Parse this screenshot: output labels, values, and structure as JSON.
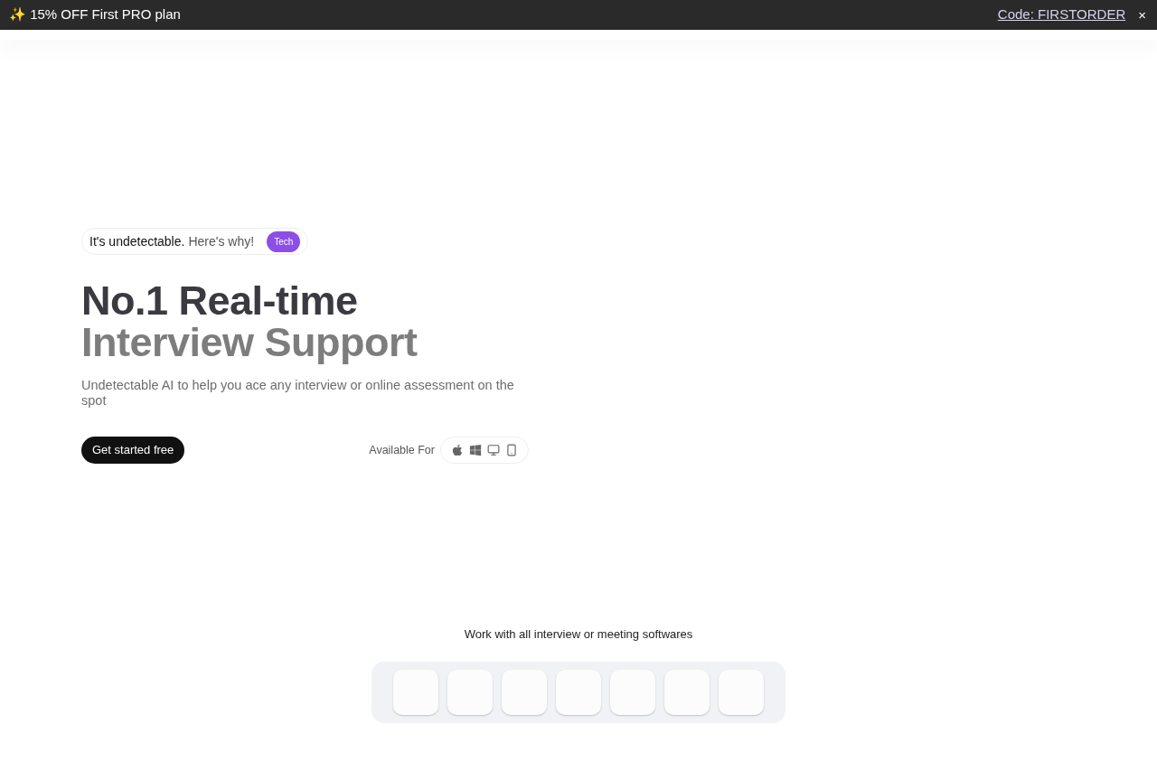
{
  "promo_banner": {
    "text": "✨ 15% OFF First PRO plan",
    "code_link": "Code: FIRSTORDER",
    "close": "×"
  },
  "hero": {
    "pill": {
      "text": "It's undetectable.",
      "link": "Here's why!",
      "badge": "Tech"
    },
    "title_line_1": "No.1 Real-time",
    "title_line_2": "Interview Support",
    "subtitle": "Undetectable AI to help you ace any interview or online assessment on the spot",
    "cta": "Get started free",
    "available_label": "Available For",
    "platforms": [
      {
        "kind": "apple"
      },
      {
        "kind": "windows"
      },
      {
        "kind": "desktop"
      },
      {
        "kind": "mobile"
      }
    ]
  },
  "software": {
    "heading": "Work with all interview or meeting softwares",
    "tiles": [
      {
        "kind": "blank"
      },
      {
        "kind": "blank"
      },
      {
        "kind": "blank"
      },
      {
        "kind": "blank"
      },
      {
        "kind": "blank"
      },
      {
        "kind": "blank"
      },
      {
        "kind": "blank"
      }
    ]
  }
}
